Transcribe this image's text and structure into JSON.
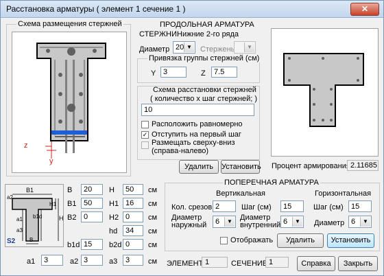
{
  "window": {
    "title": "Расстановка арматуры  ( элемент 1  сечение 1 )",
    "close_glyph": "✕"
  },
  "scheme": {
    "title": "Схема размещения стержней",
    "z_label": "z",
    "y_label": "y"
  },
  "long": {
    "title": "ПРОДОЛЬНАЯ АРМАТУРА",
    "rods_label": "СТЕРЖНИ:",
    "rods_value": "Нижние 2-го ряда",
    "diameter_label": "Диаметр",
    "diameter_value": "20",
    "rod_label": "Стержень",
    "rod_value": "",
    "anchor_title": "Привязка группы стержней (см)",
    "y_label": "Y",
    "y_value": "3",
    "z_label": "Z",
    "z_value": "7.5",
    "layout_title": "Схема расстановки стержней",
    "layout_sub": "( количество х шаг стержней; )",
    "layout_value": "10",
    "even_label": "Расположить равномерно",
    "even_checked": false,
    "first_step_label": "Отступить на первый шаг",
    "first_step_checked": true,
    "topdown_label1": "Размещать сверху-вниз",
    "topdown_label2": "(справа-налево)",
    "topdown_checked": false,
    "delete_label": "Удалить",
    "set_label": "Установить"
  },
  "percent": {
    "label": "Процент армирования",
    "value": "2.11685"
  },
  "dims": {
    "diagram_labels": {
      "b1": "B1",
      "h1": "H1",
      "a2": "a2",
      "b1d": "b1d",
      "h": "H",
      "a1": "a1",
      "a3": "a3",
      "b": "B",
      "s2": "S2"
    },
    "rows": [
      {
        "l": "B",
        "v": "20",
        "r": "H",
        "rv": "50",
        "u": "см"
      },
      {
        "l": "B1",
        "v": "50",
        "r": "H1",
        "rv": "16",
        "u": "см"
      },
      {
        "l": "B2",
        "v": "0",
        "r": "H2",
        "rv": "0",
        "u": "см"
      },
      {
        "l": "",
        "v": "",
        "r": "hd",
        "rv": "34",
        "u": "см"
      },
      {
        "l": "b1d",
        "v": "15",
        "r": "b2d",
        "rv": "0",
        "u": "см"
      },
      {
        "l": "a1",
        "v": "3",
        "r": "a2",
        "rv": "3",
        "l3": "a3",
        "v3": "3",
        "u": "см"
      }
    ]
  },
  "trans": {
    "title": "ПОПЕРЕЧНАЯ АРМАТУРА",
    "vertical": "Вертикальная",
    "horizontal": "Горизонтальная",
    "cuts_label": "Кол. срезов",
    "cuts_value": "2",
    "step_label": "Шаг  (см)",
    "step_v_value": "15",
    "step_h_value": "15",
    "outer_d_label1": "Диаметр",
    "outer_d_label2": "наружный",
    "outer_d_value": "6",
    "inner_d_label1": "Диаметр",
    "inner_d_label2": "внутренний",
    "inner_d_value": "6",
    "h_d_label": "Диаметр",
    "h_d_value": "6",
    "show_label": "Отображать",
    "show_checked": false,
    "delete_label": "Удалить",
    "set_label": "Установить"
  },
  "footer": {
    "element_label": "ЭЛЕМЕНТ",
    "element_value": "1",
    "section_label": "СЕЧЕНИЕ",
    "section_value": "1",
    "help_label": "Справка",
    "close_label": "Закрыть"
  },
  "colors": {
    "rebar_blue": "#1e5fd6",
    "marker_red": "#d02020",
    "section_fill": "#c8c8c8"
  }
}
